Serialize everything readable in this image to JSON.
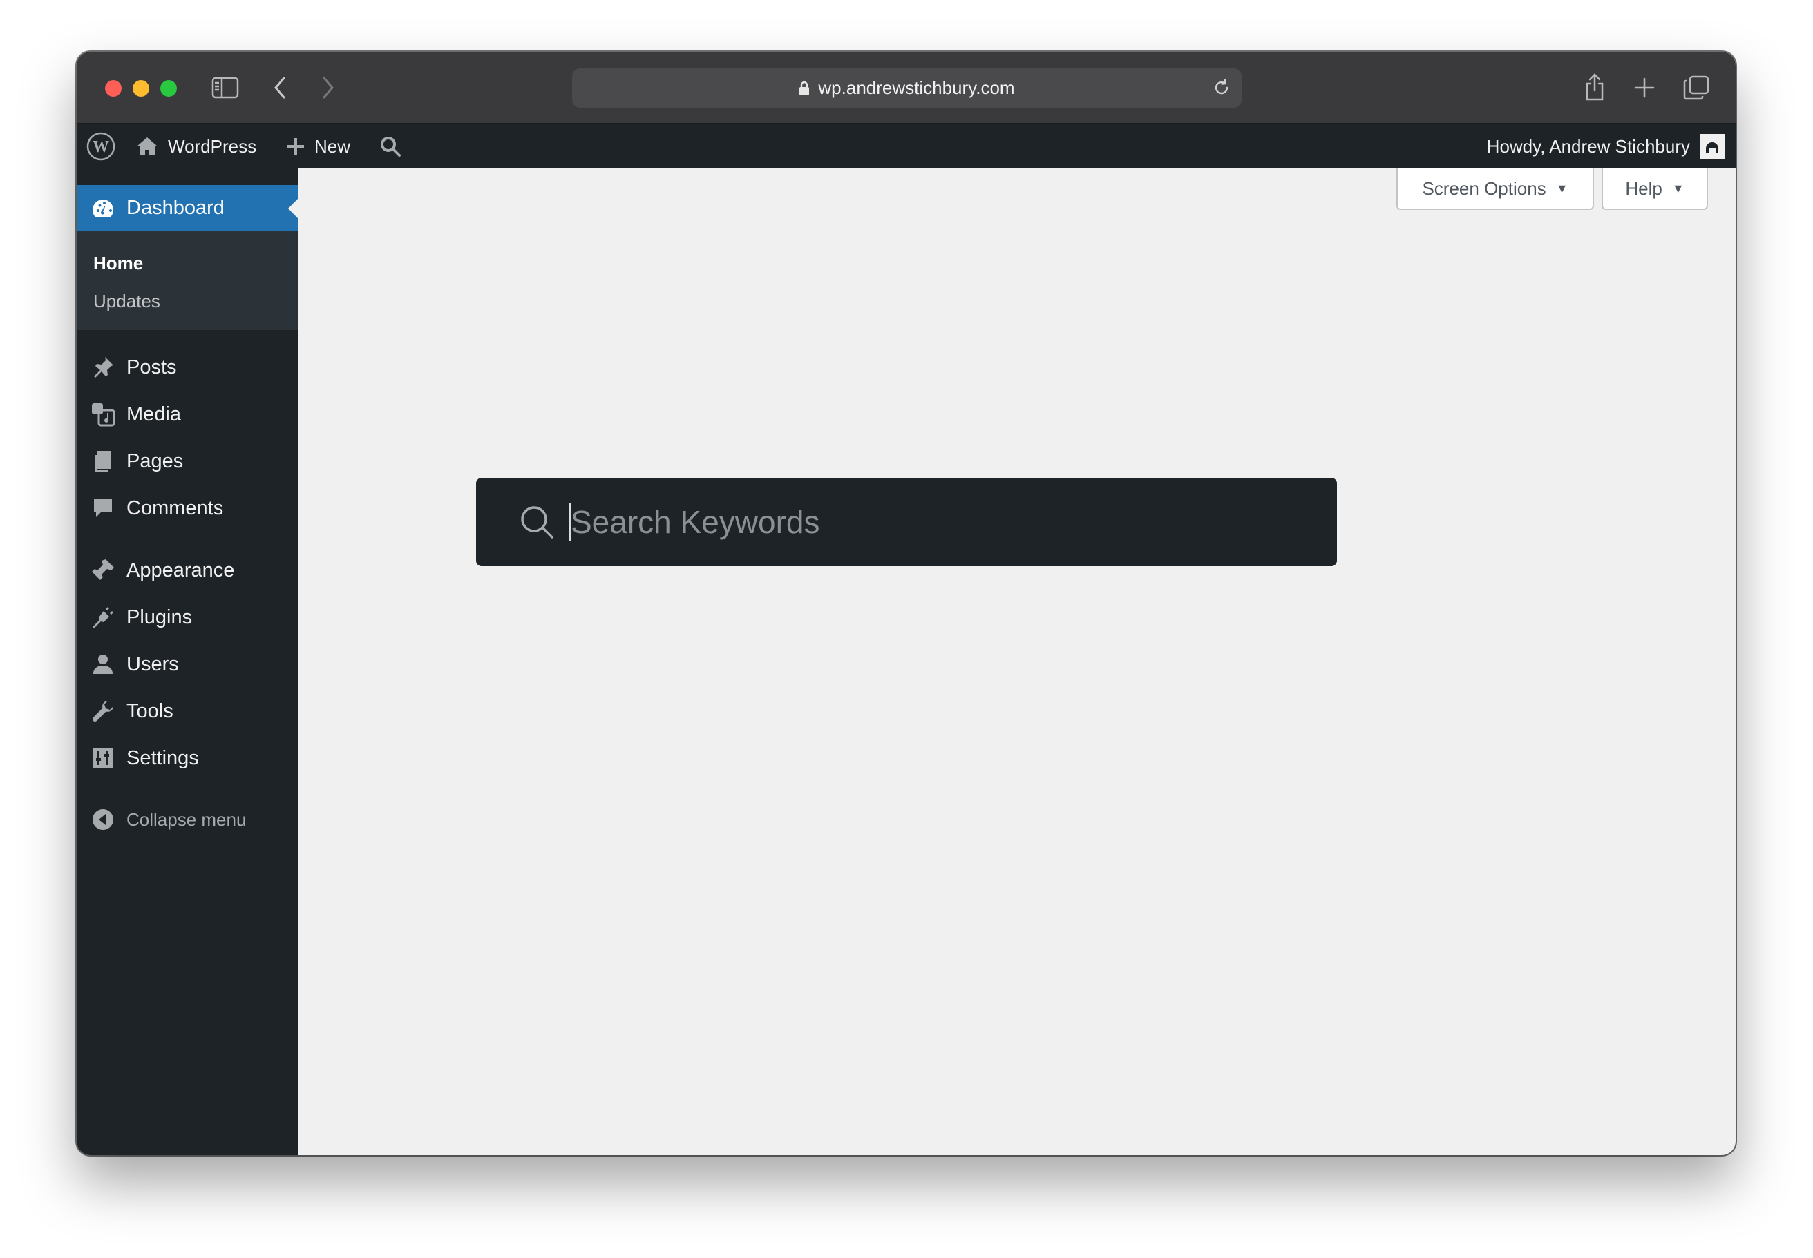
{
  "browser": {
    "url": "wp.andrewstichbury.com"
  },
  "adminbar": {
    "site_name": "WordPress",
    "new_label": "New",
    "howdy": "Howdy, Andrew Stichbury"
  },
  "sidebar": {
    "current": {
      "label": "Dashboard",
      "icon": "dashboard-icon"
    },
    "submenu": [
      {
        "label": "Home",
        "current": true
      },
      {
        "label": "Updates",
        "current": false
      }
    ],
    "items": [
      {
        "label": "Posts",
        "icon": "pin-icon"
      },
      {
        "label": "Media",
        "icon": "media-icon"
      },
      {
        "label": "Pages",
        "icon": "pages-icon"
      },
      {
        "label": "Comments",
        "icon": "comment-icon"
      },
      {
        "label": "Appearance",
        "icon": "brush-icon"
      },
      {
        "label": "Plugins",
        "icon": "plug-icon"
      },
      {
        "label": "Users",
        "icon": "user-icon"
      },
      {
        "label": "Tools",
        "icon": "wrench-icon"
      },
      {
        "label": "Settings",
        "icon": "settings-icon"
      }
    ],
    "collapse_label": "Collapse menu"
  },
  "screen_meta": {
    "screen_options": "Screen Options",
    "help": "Help"
  },
  "search": {
    "placeholder": "Search Keywords",
    "value": ""
  },
  "colors": {
    "admin_bar": "#1d2327",
    "accent": "#2271b1",
    "content_bg": "#f0f0f1"
  }
}
